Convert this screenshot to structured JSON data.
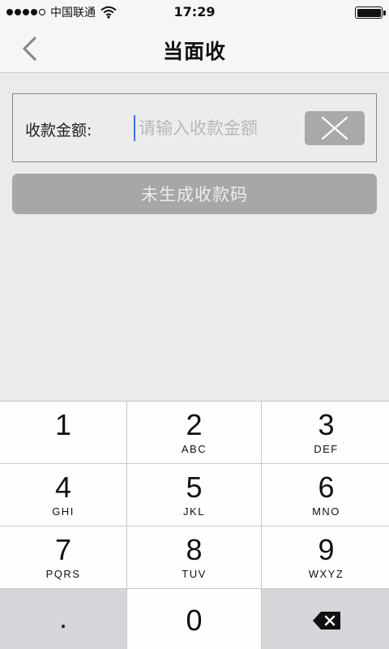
{
  "status_bar": {
    "carrier": "中国联通",
    "time": "17:29"
  },
  "nav": {
    "title": "当面收",
    "back_icon": "chevron-left-icon"
  },
  "amount_field": {
    "label": "收款金额:",
    "value": "",
    "placeholder": "请输入收款金额",
    "clear_icon": "close-icon"
  },
  "generate_button": {
    "label": "未生成收款码"
  },
  "keypad": {
    "keys": [
      {
        "num": "1",
        "letters": ""
      },
      {
        "num": "2",
        "letters": "ABC"
      },
      {
        "num": "3",
        "letters": "DEF"
      },
      {
        "num": "4",
        "letters": "GHI"
      },
      {
        "num": "5",
        "letters": "JKL"
      },
      {
        "num": "6",
        "letters": "MNO"
      },
      {
        "num": "7",
        "letters": "PQRS"
      },
      {
        "num": "8",
        "letters": "TUV"
      },
      {
        "num": "9",
        "letters": "WXYZ"
      },
      {
        "num": ".",
        "letters": ""
      },
      {
        "num": "0",
        "letters": ""
      },
      {
        "num": "",
        "letters": ""
      }
    ],
    "delete_icon": "backspace-icon"
  },
  "colors": {
    "background": "#ebebeb",
    "bar": "#f6f6f6",
    "button_disabled": "#a7a7a7",
    "cursor": "#3b6fe0"
  }
}
